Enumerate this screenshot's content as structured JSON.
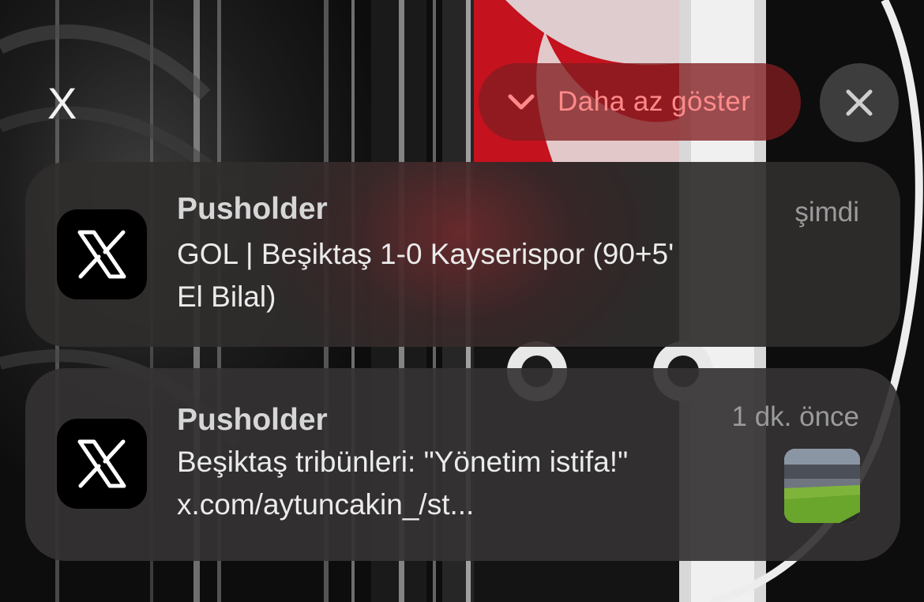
{
  "group": {
    "title": "X",
    "show_less_label": "Daha az göster",
    "colors": {
      "accent": "#ff8a8a",
      "show_less_bg": "#821c20"
    }
  },
  "notifications": [
    {
      "app": "Pusholder",
      "app_icon": "x-logo-icon",
      "time": "şimdi",
      "lines": [
        "GOL | Beşiktaş 1-0 Kayserispor (90+5'",
        "El Bilal)"
      ]
    },
    {
      "app": "Pusholder",
      "app_icon": "x-logo-icon",
      "time": "1 dk. önce",
      "lines": [
        "Beşiktaş tribünleri: \"Yönetim istifa!\"",
        "x.com/aytuncakin_/st..."
      ],
      "thumbnail": "stadium-thumbnail"
    }
  ]
}
